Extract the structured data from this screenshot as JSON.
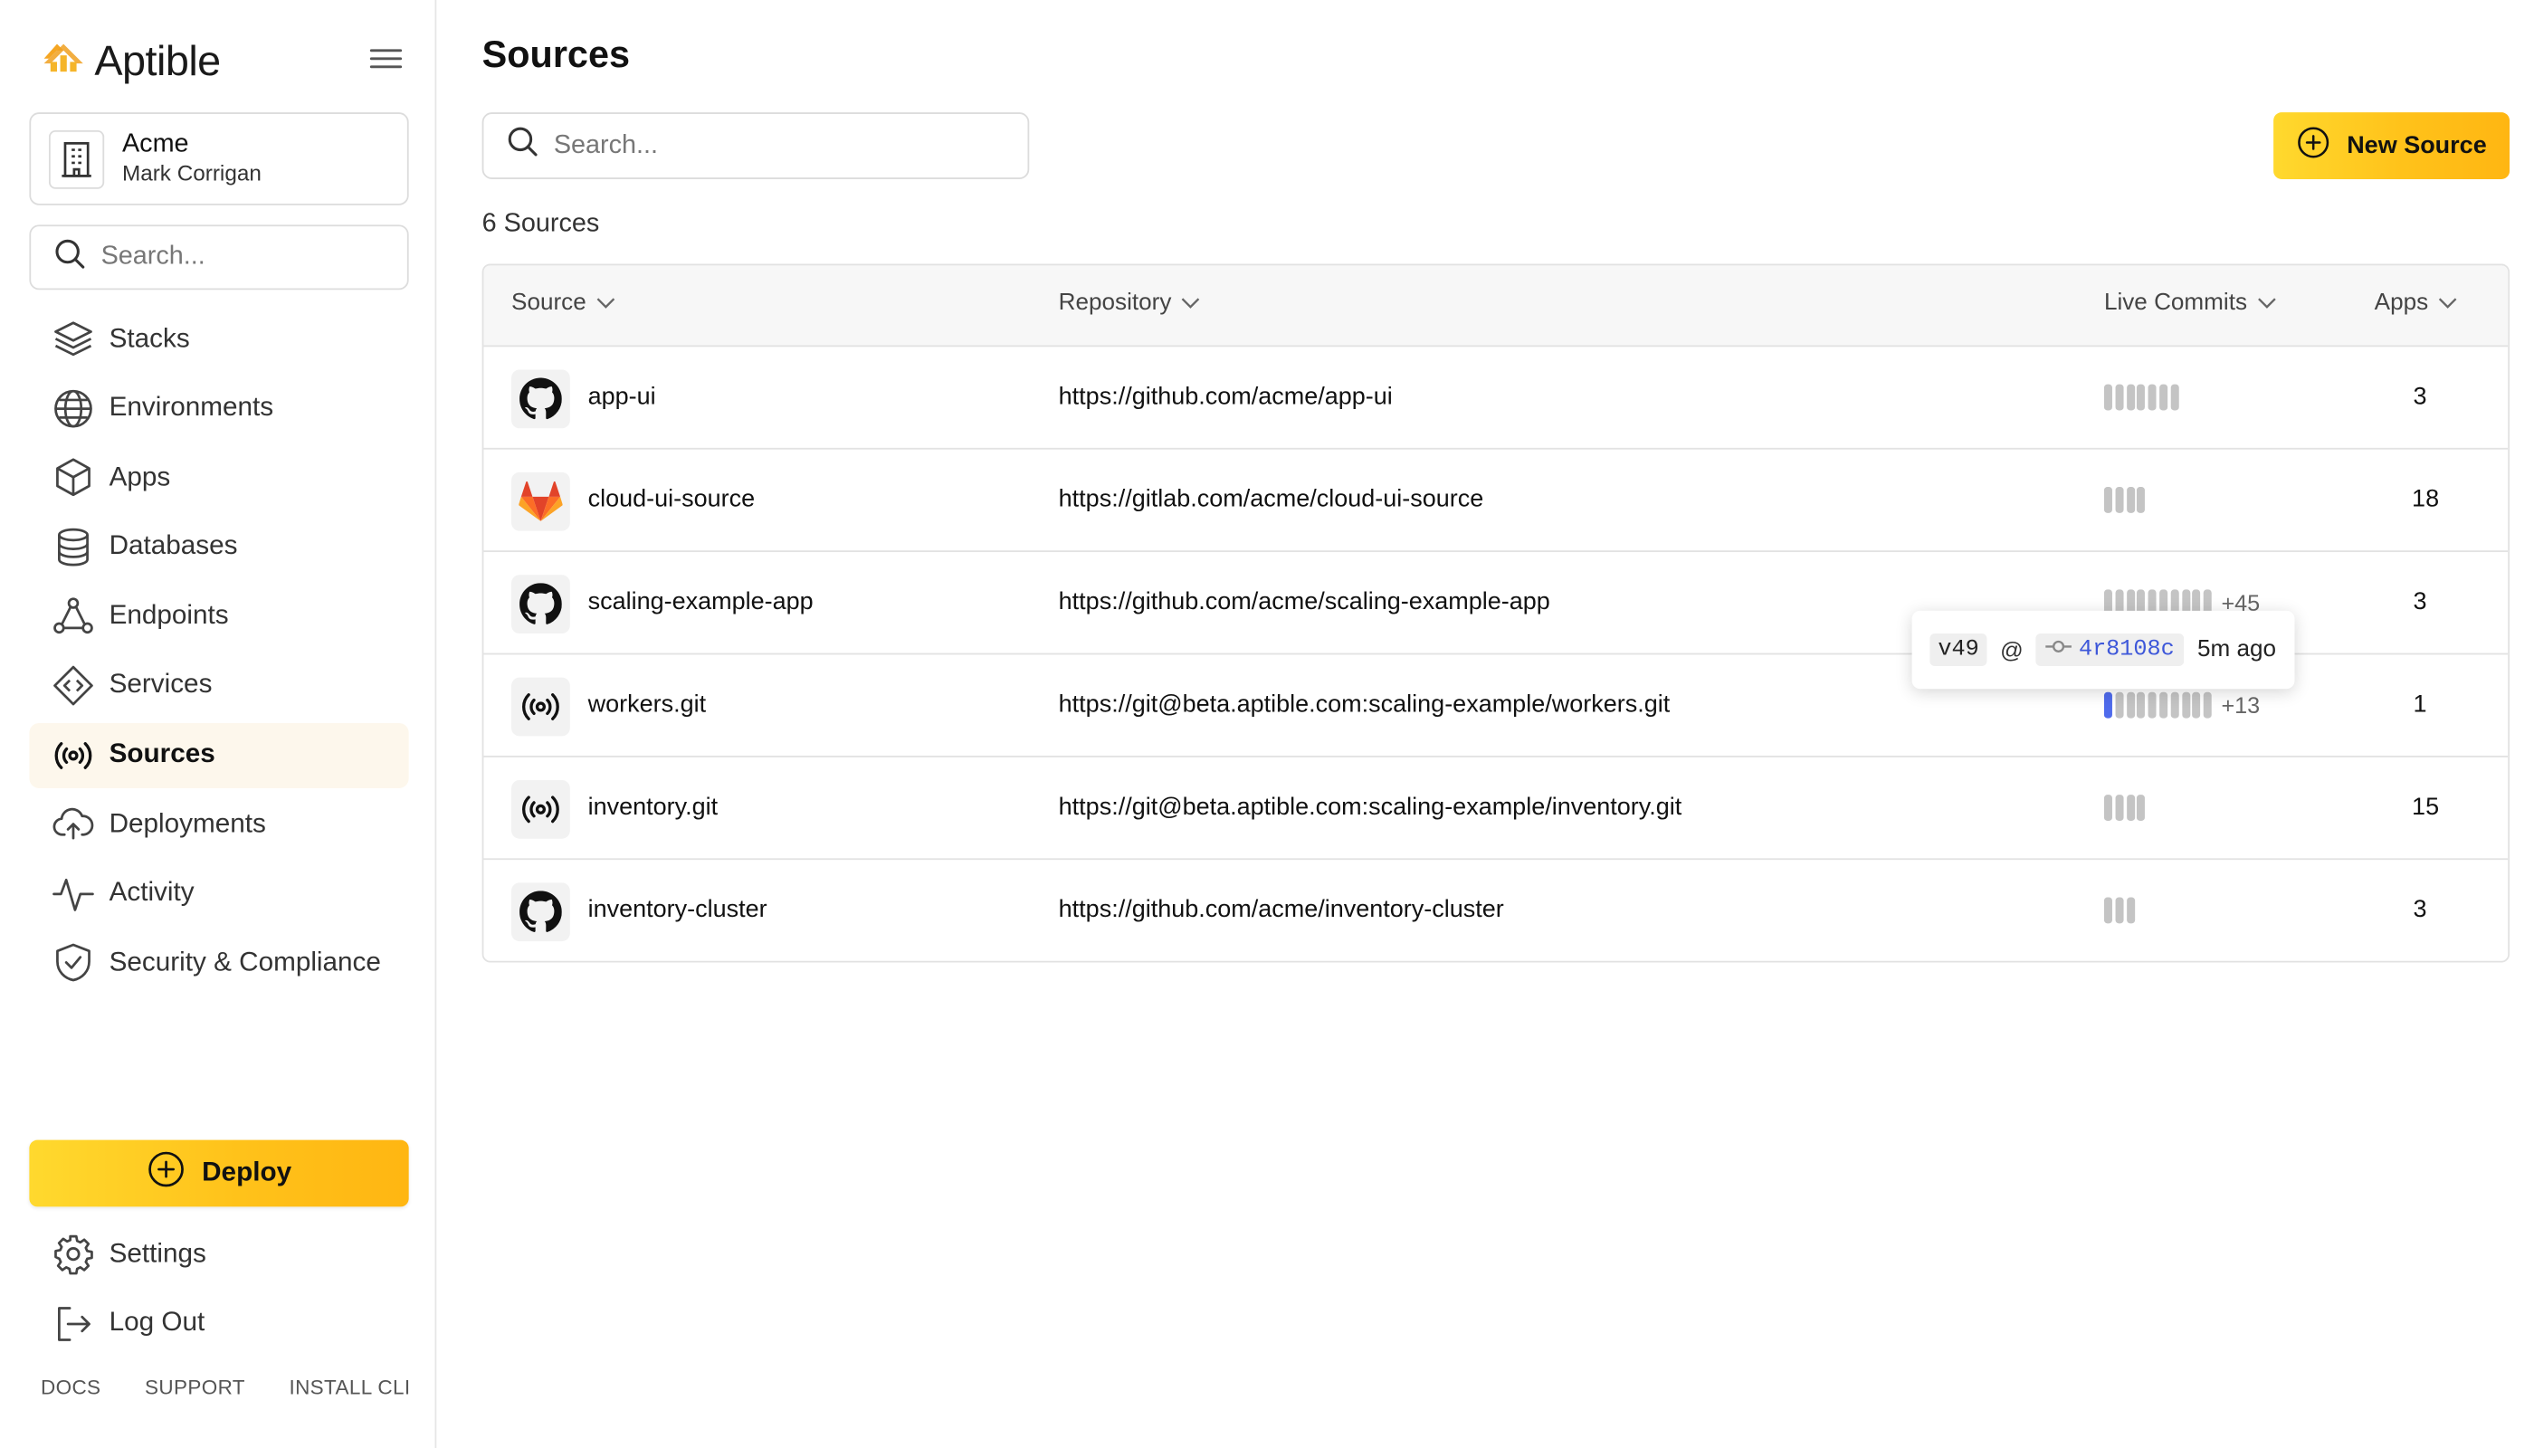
{
  "brand": {
    "name": "Aptible"
  },
  "org": {
    "name": "Acme",
    "user": "Mark Corrigan"
  },
  "sidebar": {
    "search_placeholder": "Search...",
    "items": [
      {
        "label": "Stacks",
        "icon": "layers-icon",
        "active": false
      },
      {
        "label": "Environments",
        "icon": "globe-icon",
        "active": false
      },
      {
        "label": "Apps",
        "icon": "cube-icon",
        "active": false
      },
      {
        "label": "Databases",
        "icon": "database-icon",
        "active": false
      },
      {
        "label": "Endpoints",
        "icon": "endpoints-icon",
        "active": false
      },
      {
        "label": "Services",
        "icon": "code-diamond-icon",
        "active": false
      },
      {
        "label": "Sources",
        "icon": "broadcast-icon",
        "active": true
      },
      {
        "label": "Deployments",
        "icon": "cloud-upload-icon",
        "active": false
      },
      {
        "label": "Activity",
        "icon": "activity-icon",
        "active": false
      },
      {
        "label": "Security & Compliance",
        "icon": "shield-check-icon",
        "active": false
      }
    ],
    "deploy_label": "Deploy",
    "bottom_items": [
      {
        "label": "Settings",
        "icon": "gear-icon"
      },
      {
        "label": "Log Out",
        "icon": "logout-icon"
      }
    ],
    "footer_links": [
      "DOCS",
      "SUPPORT",
      "INSTALL CLI"
    ]
  },
  "main": {
    "title": "Sources",
    "search_placeholder": "Search...",
    "new_source_label": "New Source",
    "count_text": "6 Sources",
    "columns": [
      "Source",
      "Repository",
      "Live Commits",
      "Apps"
    ],
    "rows": [
      {
        "name": "app-ui",
        "type": "github",
        "repo": "https://github.com/acme/app-ui",
        "commit_bars": 7,
        "live_index": -1,
        "more": "",
        "apps": "3"
      },
      {
        "name": "cloud-ui-source",
        "type": "gitlab",
        "repo": "https://gitlab.com/acme/cloud-ui-source",
        "commit_bars": 4,
        "live_index": -1,
        "more": "",
        "apps": "18"
      },
      {
        "name": "scaling-example-app",
        "type": "github",
        "repo": "https://github.com/acme/scaling-example-app",
        "commit_bars": 10,
        "live_index": -1,
        "more": "+45",
        "apps": "3"
      },
      {
        "name": "workers.git",
        "type": "git",
        "repo": "https://git@beta.aptible.com:scaling-example/workers.git",
        "commit_bars": 10,
        "live_index": 0,
        "more": "+13",
        "apps": "1"
      },
      {
        "name": "inventory.git",
        "type": "git",
        "repo": "https://git@beta.aptible.com:scaling-example/inventory.git",
        "commit_bars": 4,
        "live_index": -1,
        "more": "",
        "apps": "15"
      },
      {
        "name": "inventory-cluster",
        "type": "github",
        "repo": "https://github.com/acme/inventory-cluster",
        "commit_bars": 3,
        "live_index": -1,
        "more": "",
        "apps": "3"
      }
    ],
    "tooltip": {
      "version": "v49",
      "at": "@",
      "sha": "4r8108c",
      "time": "5m ago"
    }
  },
  "colors": {
    "accent": "#ffc21a",
    "live_commit": "#4f6bec",
    "commit_bar": "#c4c4c4",
    "active_nav_bg": "#fdf7ec"
  }
}
